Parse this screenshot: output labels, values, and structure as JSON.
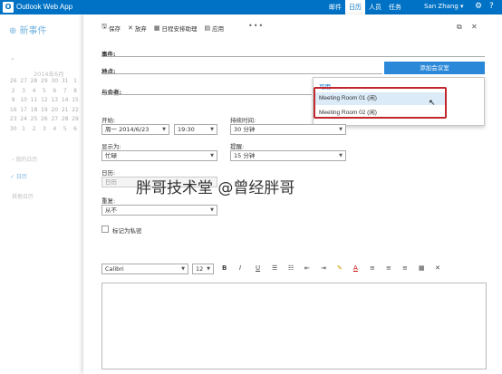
{
  "app": {
    "title": "Outlook Web App",
    "logo_letter": "O"
  },
  "topnav": [
    "邮件",
    "日历",
    "人员",
    "任务"
  ],
  "user": {
    "name": "San Zhang"
  },
  "sidebar": {
    "new_event": "⊕ 新事件",
    "cal_nav": "«",
    "month_title": "2014年6月",
    "calendar_days": [
      "26",
      "27",
      "28",
      "29",
      "30",
      "31",
      "1",
      "2",
      "3",
      "4",
      "5",
      "6",
      "7",
      "8",
      "9",
      "10",
      "11",
      "12",
      "13",
      "14",
      "15",
      "16",
      "17",
      "18",
      "19",
      "20",
      "21",
      "22",
      "23",
      "24",
      "25",
      "26",
      "27",
      "28",
      "29",
      "30",
      "1",
      "2",
      "3",
      "4",
      "5",
      "6"
    ],
    "selected_day": "23",
    "my_calendars": "‹ 我的日历",
    "calendar": "✓ 日历",
    "other_calendars": "其他日历"
  },
  "toolbar": {
    "save": "保存",
    "discard": "放弃",
    "scheduling_assistant": "日程安排助理",
    "apply": "应用",
    "more": "•••"
  },
  "form": {
    "event_label": "事件:",
    "location_label": "地点:",
    "attendees_label": "与会者:",
    "add_room_button": "添加会议室",
    "dropdown": {
      "header": "可用",
      "rooms": [
        "Meeting Room 01 (闲)",
        "Meeting Room 02 (闲)"
      ]
    },
    "start_label": "开始:",
    "start_date": "周一 2014/6/23",
    "start_time": "19:30",
    "duration_label": "持续时间:",
    "duration": "30 分钟",
    "show_as_label": "显示为:",
    "show_as": "忙碌",
    "reminder_label": "提醒:",
    "reminder": "15 分钟",
    "calendar_label": "日历:",
    "calendar": "日历",
    "repeat_label": "重复:",
    "repeat": "从不",
    "private_label": "标记为私密"
  },
  "format_bar": {
    "font": "Calibri",
    "size": "12",
    "icons": [
      "B",
      "I",
      "U",
      "☰",
      "☷",
      "⇤",
      "⇥",
      "✎",
      "A",
      "≡",
      "≡",
      "≡",
      "▦",
      "✕"
    ]
  },
  "watermark": "胖哥技术堂 @曾经胖哥",
  "colors": {
    "brand": "#0072c6",
    "highlight_border": "#c1272d",
    "hover": "#dcebf8"
  }
}
